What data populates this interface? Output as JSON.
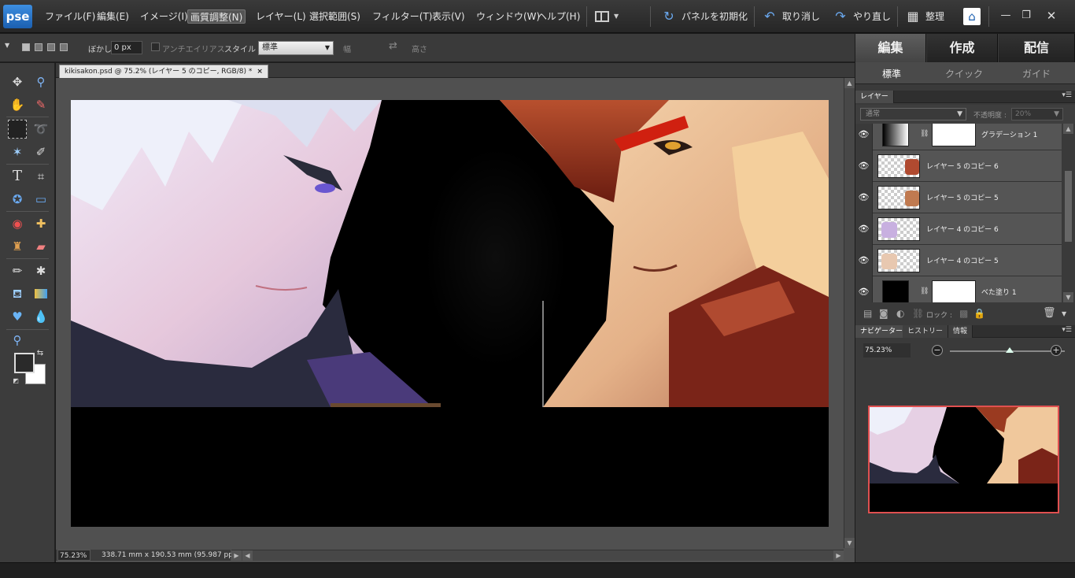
{
  "app": {
    "logo_text": "pse"
  },
  "menu": {
    "items": [
      "ファイル(F)",
      "編集(E)",
      "イメージ(I)",
      "画質調整(N)",
      "レイヤー(L)",
      "選択範囲(S)",
      "フィルター(T)",
      "表示(V)",
      "ウィンドウ(W)",
      "ヘルプ(H)"
    ],
    "active_index": 3
  },
  "toolbar": {
    "reset_panels": "パネルを初期化",
    "undo": "取り消し",
    "redo": "やり直し",
    "organize": "整理"
  },
  "options": {
    "feather_label": "ぼかし :",
    "feather_value": "0 px",
    "antialias_label": "アンチエイリアス",
    "style_label": "スタイル :",
    "style_value": "標準",
    "width_label": "幅",
    "height_label": "高さ"
  },
  "document": {
    "tab_title": "kikisakon.psd @ 75.2% (レイヤー 5 のコピー, RGB/8) *",
    "tab_close": "×",
    "zoom": "75.23%",
    "dimensions": "338.71 mm x 190.53 mm (95.987 ppi)"
  },
  "modes": {
    "tabs": [
      "編集",
      "作成",
      "配信"
    ],
    "active_index": 0,
    "subtabs": [
      "標準",
      "クイック",
      "ガイド"
    ],
    "active_subtab": 0
  },
  "layers_panel": {
    "tab_label": "レイヤー",
    "blend_mode": "通常",
    "opacity_label": "不透明度 :",
    "opacity_value": "20%",
    "lock_label": "ロック :",
    "layers": [
      {
        "name": "グラデーション 1",
        "kind": "gradient"
      },
      {
        "name": "レイヤー 5 のコピー 6",
        "kind": "image-red"
      },
      {
        "name": "レイヤー 5 のコピー 5",
        "kind": "image-red"
      },
      {
        "name": "レイヤー 4 のコピー 6",
        "kind": "image-white"
      },
      {
        "name": "レイヤー 4 のコピー 5",
        "kind": "image-white"
      },
      {
        "name": "べた塗り 1",
        "kind": "fill"
      }
    ]
  },
  "navigator_panel": {
    "tabs": [
      "ナビゲーター",
      "ヒストリー",
      "情報"
    ],
    "active_index": 0,
    "zoom": "75.23%",
    "zoom_fraction": 0.52
  },
  "colors": {
    "accent": "#3d8ee0",
    "nav_frame": "#e05050",
    "foreground": "#2a2a2a",
    "background": "#ffffff"
  }
}
